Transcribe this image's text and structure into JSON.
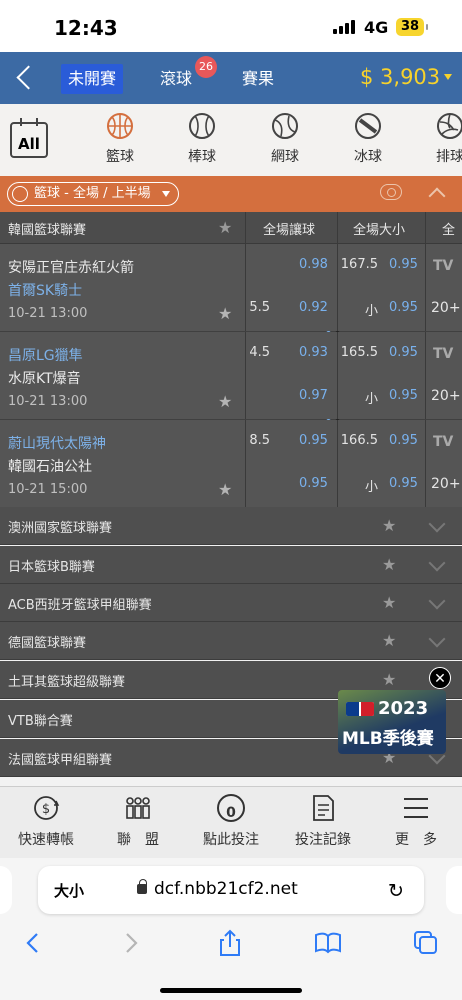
{
  "status_bar": {
    "time": "12:43",
    "network": "4G",
    "battery": "38"
  },
  "nav": {
    "tabs": [
      {
        "label": "未開賽",
        "active": true
      },
      {
        "label": "滾球",
        "badge": "26"
      },
      {
        "label": "賽果"
      }
    ],
    "balance": "$ 3,903"
  },
  "sports": [
    {
      "label": "All",
      "icon": "calendar-all-icon"
    },
    {
      "label": "籃球",
      "icon": "basketball-icon",
      "active": true
    },
    {
      "label": "棒球",
      "icon": "baseball-icon"
    },
    {
      "label": "網球",
      "icon": "tennis-icon"
    },
    {
      "label": "冰球",
      "icon": "hockey-puck-icon"
    },
    {
      "label": "排球",
      "icon": "volleyball-icon"
    }
  ],
  "filter": {
    "label": "籃球 - 全場 / 上半場"
  },
  "table_header": {
    "league": "韓國籃球聯賽",
    "col1": "全場讓球",
    "col2": "全場大小",
    "col3": "全"
  },
  "matches": [
    {
      "home": "安陽正官庄赤紅火箭",
      "away": "首爾SK騎士",
      "time": "10-21 13:00",
      "r1": {
        "hcap": "",
        "odd": "0.98",
        "line": "167.5",
        "odd2": "0.95"
      },
      "r2": {
        "hcap": "5.5",
        "odd": "0.92",
        "line": "小",
        "odd2": "0.95"
      },
      "home_blue": false,
      "away_blue": true,
      "tv": "TV",
      "more": "20+"
    },
    {
      "home": "昌原LG獵隼",
      "away": "水原KT爆音",
      "time": "10-21 13:00",
      "r1": {
        "hcap": "4.5",
        "odd": "0.93",
        "line": "165.5",
        "odd2": "0.95"
      },
      "r2": {
        "hcap": "",
        "odd": "0.97",
        "line": "小",
        "odd2": "0.95"
      },
      "home_blue": true,
      "away_blue": false,
      "tv": "TV",
      "more": "20+"
    },
    {
      "home": "蔚山現代太陽神",
      "away": "韓國石油公社",
      "time": "10-21 15:00",
      "r1": {
        "hcap": "8.5",
        "odd": "0.95",
        "line": "166.5",
        "odd2": "0.95"
      },
      "r2": {
        "hcap": "",
        "odd": "0.95",
        "line": "小",
        "odd2": "0.95"
      },
      "home_blue": true,
      "away_blue": false,
      "tv": "TV",
      "more": "20+"
    }
  ],
  "leagues": [
    "澳洲國家籃球聯賽",
    "日本籃球B聯賽",
    "ACB西班牙籃球甲組聯賽",
    "德國籃球聯賽",
    "土耳其籃球超級聯賽",
    "VTB聯合賽",
    "法國籃球甲組聯賽"
  ],
  "promo": {
    "year": "2023",
    "title": "MLB季後賽"
  },
  "bottom_nav": [
    {
      "label": "快速轉帳",
      "icon": "transfer-icon"
    },
    {
      "label": "聯　盟",
      "icon": "league-icon"
    },
    {
      "label": "點此投注",
      "icon": "bet-slip-icon",
      "count": "0"
    },
    {
      "label": "投注記錄",
      "icon": "record-icon"
    },
    {
      "label": "更　多",
      "icon": "menu-icon"
    }
  ],
  "browser": {
    "text_size": "大小",
    "url": "dcf.nbb21cf2.net"
  },
  "colors": {
    "nav": "#3c6aa4",
    "accent": "#d46f3e",
    "balance": "#f7d22b",
    "odds": "#79b1ed"
  }
}
